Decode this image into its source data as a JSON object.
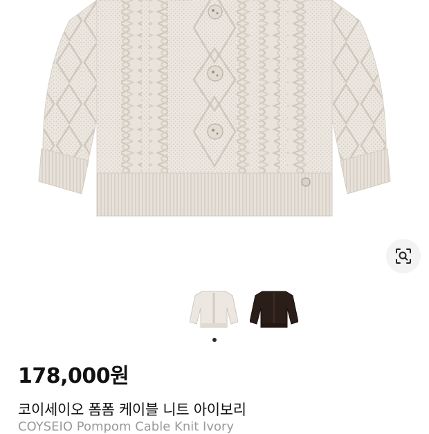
{
  "product": {
    "price": "178,000원",
    "name_ko": "코이세이오 폼폼 케이블 니트 아이보리",
    "name_en": "COYSEIO Pompom Cable Knit Ivory"
  },
  "gallery": {
    "main_image": "ivory-cable-knit-sweater",
    "thumbnails": [
      {
        "name": "ivory-sweater-thumb",
        "color": "#ece7e0"
      },
      {
        "name": "dark-brown-sweater-thumb",
        "color": "#2b1d18"
      }
    ],
    "active_dot": 1
  },
  "icons": {
    "lens": "image-search-icon"
  },
  "colors": {
    "sweater": "#ece7e0",
    "sweater_shade": "#d9d3ca",
    "lens_bg": "#f3f3f3"
  }
}
